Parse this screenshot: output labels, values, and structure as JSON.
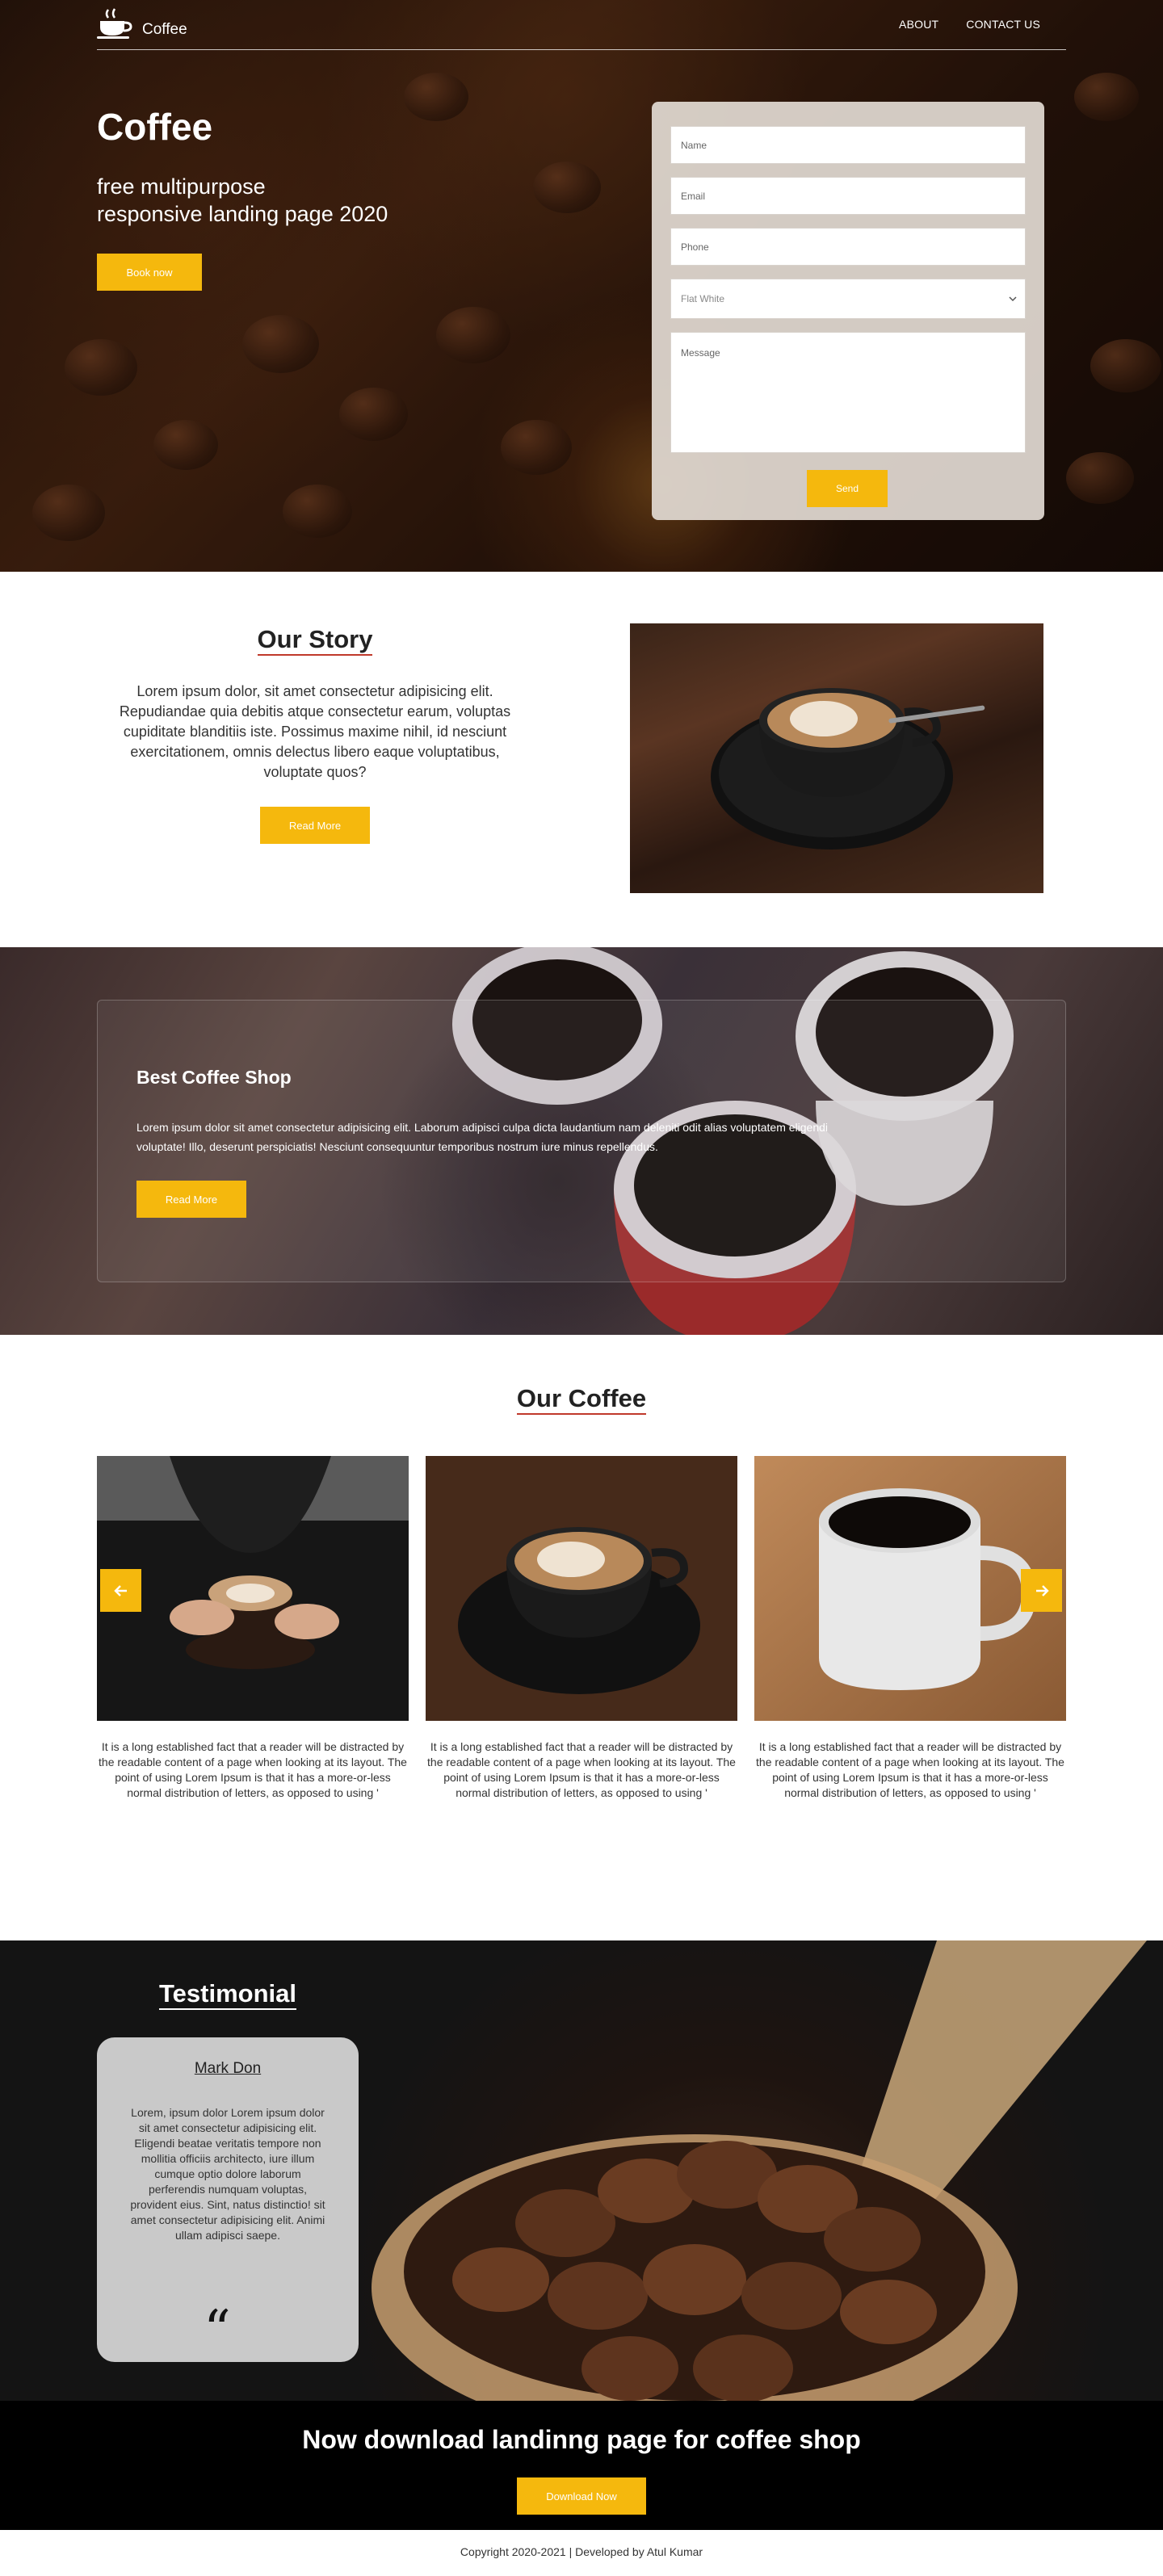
{
  "nav": {
    "logo_text": "Coffee",
    "links": [
      "ABOUT",
      "CONTACT US"
    ]
  },
  "hero": {
    "title": "Coffee",
    "subtitle_line1": "free multipurpose",
    "subtitle_line2": "responsive landing page 2020",
    "book_button": "Book now"
  },
  "form": {
    "name_placeholder": "Name",
    "email_placeholder": "Email",
    "phone_placeholder": "Phone",
    "select_value": "Flat White",
    "message_placeholder": "Message",
    "send_button": "Send"
  },
  "story": {
    "title": "Our Story",
    "text": "Lorem ipsum dolor, sit amet consectetur adipisicing elit. Repudiandae quia debitis atque consectetur earum, voluptas cupiditate blanditiis iste. Possimus maxime nihil, id nesciunt exercitationem, omnis delectus libero eaque voluptatibus, voluptate quos?",
    "button": "Read More"
  },
  "shop": {
    "title": "Best Coffee Shop",
    "text": "Lorem ipsum dolor sit amet consectetur adipisicing elit. Laborum adipisci culpa dicta laudantium nam deleniti odit alias voluptatem eligendi voluptate! Illo, deserunt perspiciatis! Nesciunt consequuntur temporibus nostrum iure minus repellendus.",
    "button": "Read More"
  },
  "coffee": {
    "title": "Our Coffee",
    "cards": [
      {
        "text": "It is a long established fact that a reader will be distracted by the readable content of a page when looking at its layout. The point of using Lorem Ipsum is that it has a more-or-less normal distribution of letters, as opposed to using '"
      },
      {
        "text": "It is a long established fact that a reader will be distracted by the readable content of a page when looking at its layout. The point of using Lorem Ipsum is that it has a more-or-less normal distribution of letters, as opposed to using '"
      },
      {
        "text": "It is a long established fact that a reader will be distracted by the readable content of a page when looking at its layout. The point of using Lorem Ipsum is that it has a more-or-less normal distribution of letters, as opposed to using '"
      }
    ],
    "prev_icon": "arrow-left-icon",
    "next_icon": "arrow-right-icon"
  },
  "testimonial": {
    "title": "Testimonial",
    "name": "Mark Don",
    "text": "Lorem, ipsum dolor Lorem ipsum dolor sit amet consectetur adipisicing elit. Eligendi beatae veritatis tempore non mollitia officiis architecto, iure illum cumque optio dolore laborum perferendis numquam voluptas, provident eius. Sint, natus distinctio! sit amet consectetur adipisicing elit. Animi ullam adipisci saepe.",
    "quote_icon": "quote-icon"
  },
  "download": {
    "title": "Now download landinng page for coffee shop",
    "button": "Download Now"
  },
  "footer": {
    "copyright": "Copyright 2020-2021 | Developed by Atul Kumar"
  },
  "colors": {
    "accent": "#f5b80d",
    "underline": "#c0392b",
    "dark_band": "#000000"
  }
}
